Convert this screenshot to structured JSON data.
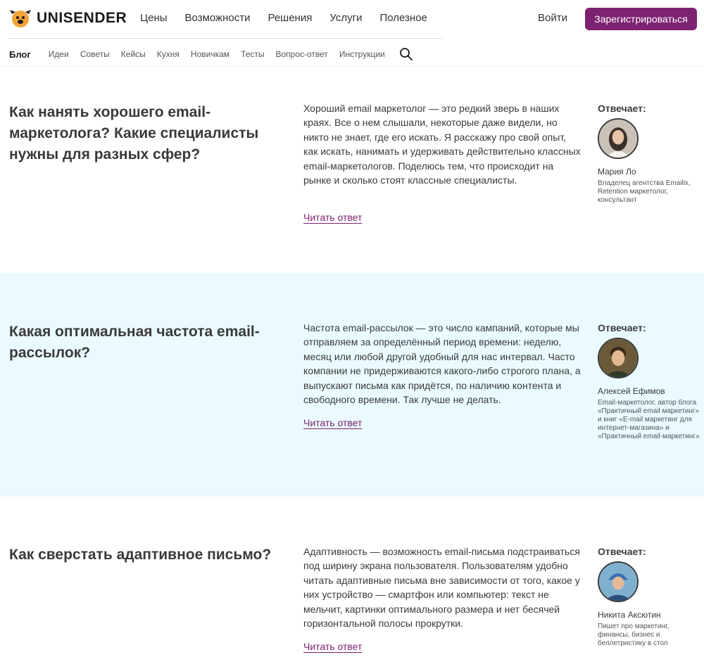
{
  "header": {
    "logo_text": "UNISENDER",
    "nav": [
      "Цены",
      "Возможности",
      "Решения",
      "Услуги",
      "Полезное"
    ],
    "login_label": "Войти",
    "signup_label": "Зарегистрироваться"
  },
  "subnav": {
    "items": [
      "Блог",
      "Идеи",
      "Советы",
      "Кейсы",
      "Кухня",
      "Новичкам",
      "Тесты",
      "Вопрос-ответ",
      "Инструкции"
    ]
  },
  "qa": [
    {
      "question": "Как нанять хорошего email-маркетолога? Какие специалисты нужны для разных сфер?",
      "answer": "Хороший email маркетолог — это редкий зверь в наших краях. Все о нем слышали, некоторые даже видели, но никто не знает, где его искать. Я расскажу про свой опыт, как искать, нанимать и удерживать действительно классных email-маркетологов. Поделюсь тем, что происходит на рынке и сколько стоят классные специалисты.",
      "link": "Читать ответ",
      "answers_label": "Отвечает:",
      "name": "Мария Ло",
      "role": "Владелец агентства Emailix, Retention маркетолог, консультант"
    },
    {
      "question": "Какая оптимальная частота email-рассылок?",
      "answer": "Частота email-рассылок — это число кампаний, которые мы отправляем за определённый период времени: неделю, месяц или любой другой удобный для нас интервал. Часто компании не придерживаются какого-либо строгого плана, а выпускают письма как придётся, по наличию контента и свободного времени. Так лучше не делать.",
      "link": "Читать ответ",
      "answers_label": "Отвечает:",
      "name": "Алексей Ефимов",
      "role": "Email-маркетолог, автор блога «Практичный email маркетинг» и книг «E-mail маркетинг для интернет-магазина» и «Практичный email-маркетинг»"
    },
    {
      "question": "Как сверстать адаптивное письмо?",
      "answer": "Адаптивность — возможность email-письма подстраиваться под ширину экрана пользователя. Пользователям удобно читать адаптивные письма вне зависимости от того, какое у них устройство — смартфон или компьютер: текст не мельчит, картинки оптимального размера и нет бесячей горизонтальной полосы прокрутки.",
      "link": "Читать ответ",
      "answers_label": "Отвечает:",
      "name": "Никита Аксютин",
      "role": "Пишет про маркетинг, финансы, бизнес и беллетристику в стол"
    }
  ],
  "colors": {
    "accent": "#7d2271",
    "highlight_bg": "#eafaff",
    "logo_orange": "#f2a33a"
  }
}
